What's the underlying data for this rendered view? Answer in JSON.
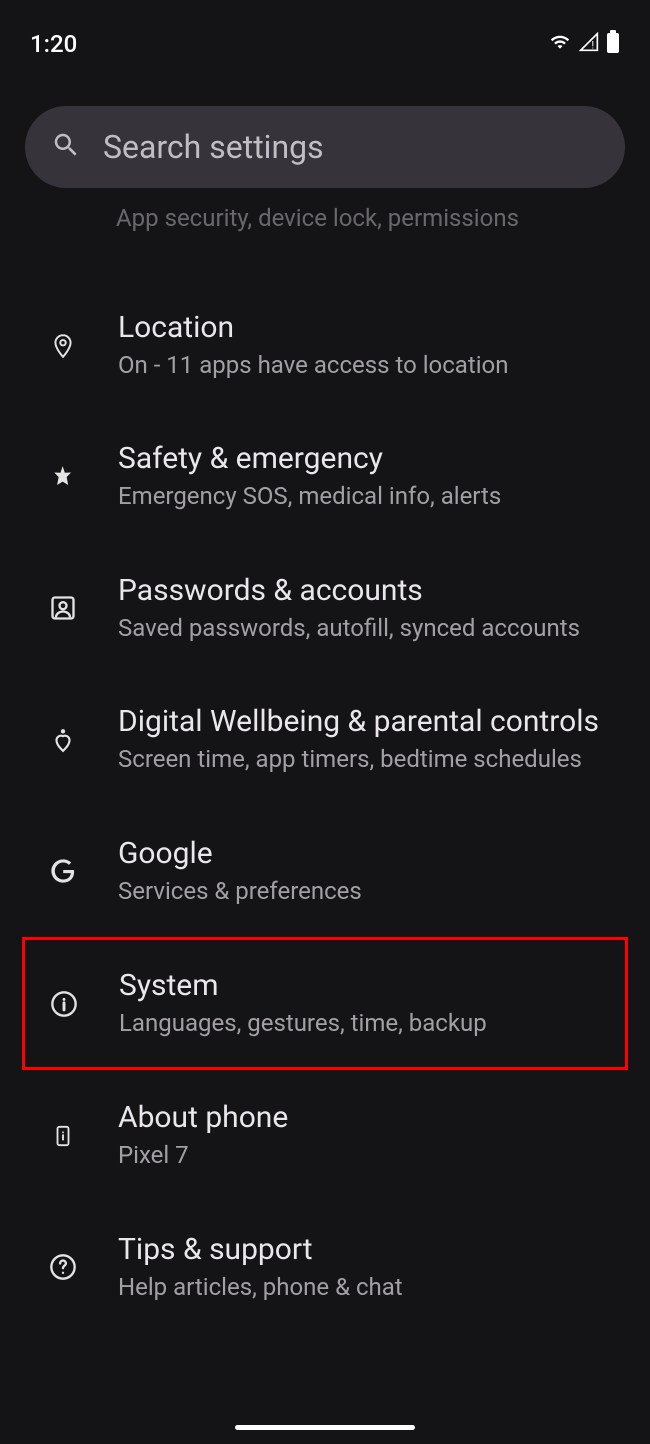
{
  "status": {
    "time": "1:20"
  },
  "search": {
    "placeholder": "Search settings"
  },
  "partial": {
    "subtitle": "App security, device lock, permissions"
  },
  "items": [
    {
      "title": "Location",
      "subtitle": "On - 11 apps have access to location"
    },
    {
      "title": "Safety & emergency",
      "subtitle": "Emergency SOS, medical info, alerts"
    },
    {
      "title": "Passwords & accounts",
      "subtitle": "Saved passwords, autofill, synced accounts"
    },
    {
      "title": "Digital Wellbeing & parental controls",
      "subtitle": "Screen time, app timers, bedtime schedules"
    },
    {
      "title": "Google",
      "subtitle": "Services & preferences"
    },
    {
      "title": "System",
      "subtitle": "Languages, gestures, time, backup"
    },
    {
      "title": "About phone",
      "subtitle": "Pixel 7"
    },
    {
      "title": "Tips & support",
      "subtitle": "Help articles, phone & chat"
    }
  ]
}
